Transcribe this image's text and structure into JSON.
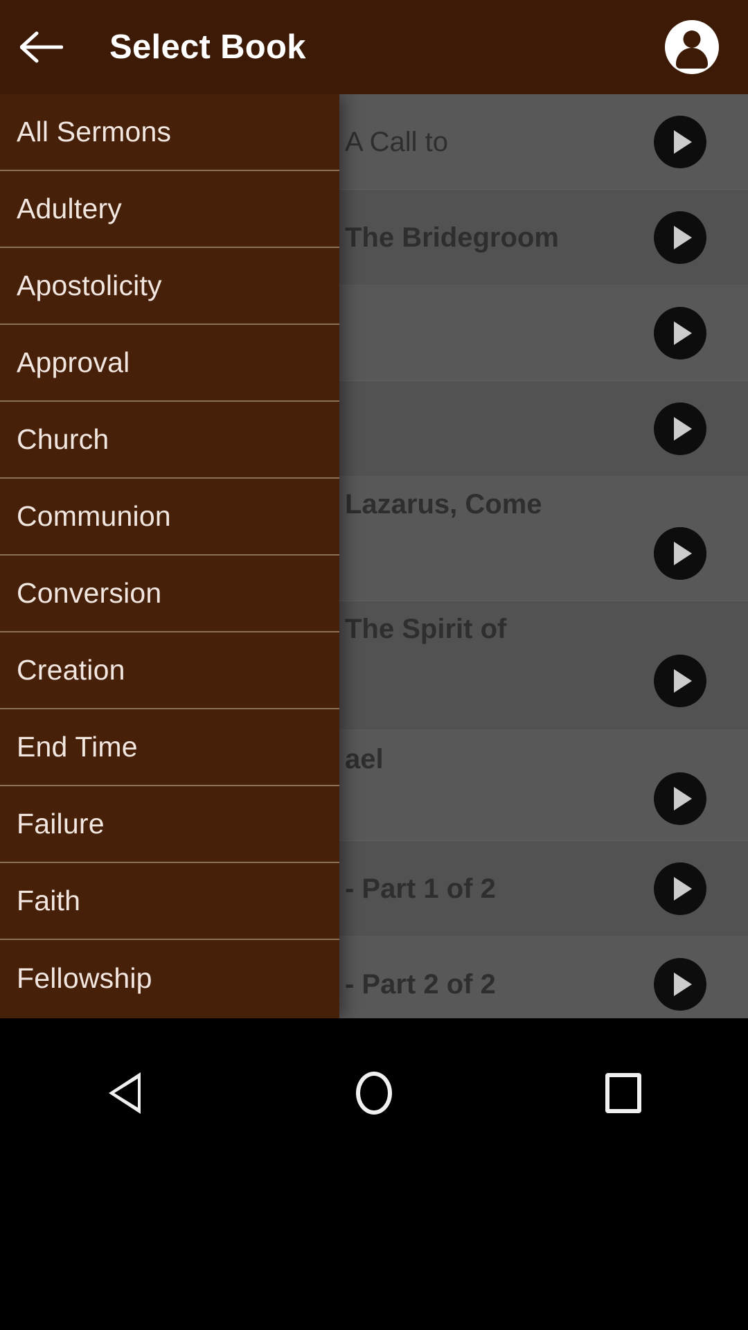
{
  "appbar": {
    "back_icon": "arrow-left-icon",
    "title": "Select Book",
    "account_icon": "account-circle-icon"
  },
  "drawer": {
    "items": [
      {
        "label": "All Sermons"
      },
      {
        "label": "Adultery"
      },
      {
        "label": "Apostolicity"
      },
      {
        "label": "Approval"
      },
      {
        "label": "Church"
      },
      {
        "label": "Communion"
      },
      {
        "label": "Conversion"
      },
      {
        "label": "Creation"
      },
      {
        "label": "End Time"
      },
      {
        "label": "Failure"
      },
      {
        "label": "Faith"
      },
      {
        "label": "Fellowship"
      }
    ]
  },
  "background_list": {
    "play_icon": "play-circle-icon",
    "rows": [
      {
        "title": "A Call to",
        "bold": false
      },
      {
        "title": "The Bridegroom",
        "bold": true
      },
      {
        "title": "",
        "bold": false
      },
      {
        "title": "",
        "bold": false
      },
      {
        "title": "Lazarus, Come",
        "bold": true
      },
      {
        "title": "The Spirit of",
        "bold": true
      },
      {
        "title": "ael",
        "bold": true
      },
      {
        "title": "- Part 1 of 2",
        "bold": true
      },
      {
        "title": "- Part 2 of 2",
        "bold": true
      }
    ]
  },
  "system_nav": {
    "back_label": "back-icon",
    "home_label": "home-icon",
    "recents_label": "recents-icon"
  },
  "colors": {
    "appbar_bg": "#3c1a06",
    "drawer_bg": "#47200a",
    "drawer_divider": "#8a7156",
    "drawer_text": "#f2e7e0",
    "scrim": "rgba(0,0,0,0.20)",
    "play_button": "#111111",
    "sysnav_bg": "#000000"
  }
}
